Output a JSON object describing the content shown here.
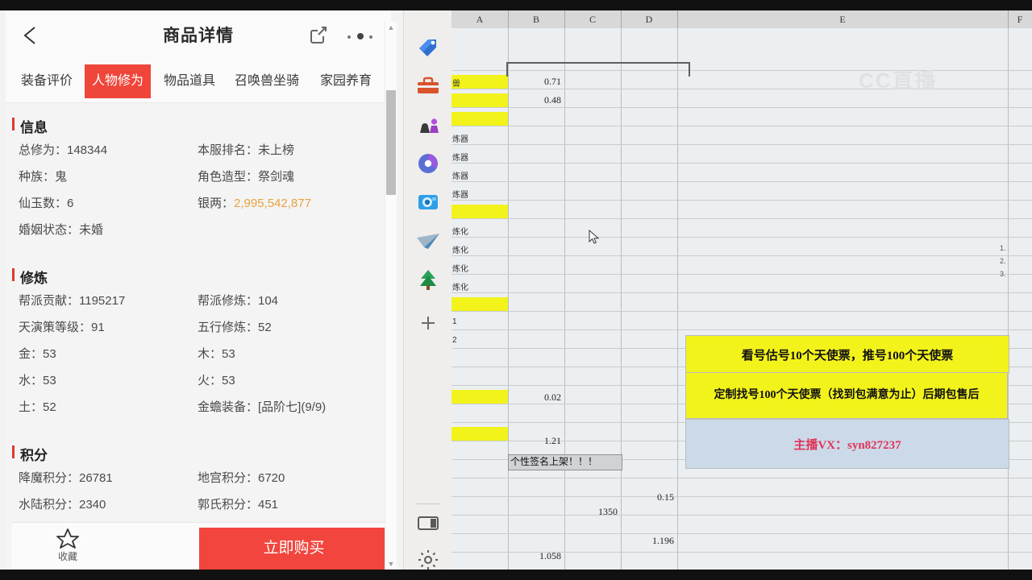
{
  "phone": {
    "appbar": {
      "title": "商品详情",
      "back_icon": "back-arrow-icon",
      "share_icon": "share-icon",
      "more_icon": "more-dots-icon"
    },
    "tabs": [
      {
        "label": "装备评价",
        "active": false
      },
      {
        "label": "人物修为",
        "active": true
      },
      {
        "label": "物品道具",
        "active": false
      },
      {
        "label": "召唤兽坐骑",
        "active": false
      },
      {
        "label": "家园养育",
        "active": false
      }
    ],
    "sections": [
      {
        "title": "信息",
        "rows": [
          {
            "left": "总修为：148344",
            "right": "本服排名：未上榜"
          },
          {
            "left": "种族：鬼",
            "right": "角色造型：祭剑魂"
          },
          {
            "left": "仙玉数：6",
            "right_label": "银两：",
            "right_value": "2,995,542,877",
            "right_gold": true
          },
          {
            "left": "婚姻状态：未婚",
            "right": ""
          }
        ]
      },
      {
        "title": "修炼",
        "rows": [
          {
            "left": "帮派贡献：1195217",
            "right": "帮派修炼：104"
          },
          {
            "left": "天演策等级：91",
            "right": "五行修炼：52"
          },
          {
            "left": "金：53",
            "right": "木：53"
          },
          {
            "left": "水：53",
            "right": "火：53"
          },
          {
            "left": "土：52",
            "right": "金蟾装备：[品阶七](9/9)"
          }
        ]
      },
      {
        "title": "积分",
        "rows": [
          {
            "left": "降魔积分：26781",
            "right": "地宫积分：6720"
          },
          {
            "left": "水陆积分：2340",
            "right": "郭氏积分：451"
          }
        ]
      }
    ],
    "bottom": {
      "favorite_label": "收藏",
      "favorite_icon": "star-icon",
      "buy_label": "立即购买"
    },
    "scrollbar": {
      "up_arrow": "▲",
      "down_arrow": "▼"
    }
  },
  "rail": {
    "icons": [
      {
        "name": "price-tag-icon",
        "glyph": "🏷"
      },
      {
        "name": "toolbox-icon",
        "glyph": "🧰"
      },
      {
        "name": "chess-pieces-icon",
        "glyph": "♟"
      },
      {
        "name": "color-hexagon-icon",
        "glyph": "⬣"
      },
      {
        "name": "mail-camera-icon",
        "glyph": "📷"
      },
      {
        "name": "paper-plane-icon",
        "glyph": "✈"
      },
      {
        "name": "tree-icon",
        "glyph": "🌲"
      },
      {
        "name": "add-app-icon",
        "glyph": "+"
      },
      {
        "name": "split-pane-icon",
        "glyph": "▯"
      },
      {
        "name": "settings-gear-icon",
        "glyph": "⚙"
      }
    ]
  },
  "sheet": {
    "watermark": "CC直播",
    "columns": [
      "A",
      "B",
      "C",
      "D",
      "E",
      "F"
    ],
    "callouts": [
      {
        "name": "quote-price-box",
        "text": "看号估号10个天使票，推号100个天使票"
      },
      {
        "name": "custom-search-box",
        "text": "定制找号100个天使票（找到包满意为止）后期包售后"
      },
      {
        "name": "streamer-vx-box",
        "text": "主播VX：syn827237"
      }
    ],
    "selected_cell": "个性签名上架！！！",
    "b_values": [
      "0.71",
      "0.48",
      "0.02",
      "1.21",
      "1.058"
    ],
    "other_values": [
      {
        "col": "D",
        "value": "0.15"
      },
      {
        "col": "C",
        "value": "1350"
      },
      {
        "col": "D",
        "value": "1.196"
      }
    ],
    "a_labels": [
      "兽",
      "",
      "",
      "炼器",
      "炼器",
      "炼器",
      "炼器",
      "炼器",
      "",
      "炼化",
      "炼化",
      "炼化",
      "炼化",
      "炼化",
      "",
      "1",
      "2",
      "",
      "",
      "",
      "",
      "",
      "",
      "",
      ""
    ],
    "notes": [
      "1.",
      "2.",
      "3."
    ],
    "cursor": "mouse-pointer"
  }
}
